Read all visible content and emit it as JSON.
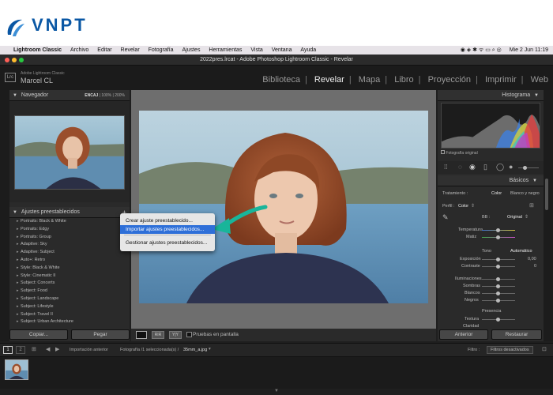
{
  "brand": {
    "name": "VNPT",
    "color": "#0a57a4"
  },
  "menubar": {
    "app": "Lightroom Classic",
    "items": [
      "Archivo",
      "Editar",
      "Revelar",
      "Fotografía",
      "Ajustes",
      "Herramientas",
      "Vista",
      "Ventana",
      "Ayuda"
    ],
    "datetime": "Mie 2 Jun 11:19"
  },
  "window": {
    "title": "2022pres.lrcat - Adobe Photoshop Lightroom Classic - Revelar"
  },
  "identity": {
    "logo": "Lrc",
    "product": "Adobe Lightroom Classic",
    "user": "Marcel CL"
  },
  "modules": {
    "items": [
      "Biblioteca",
      "Revelar",
      "Mapa",
      "Libro",
      "Proyección",
      "Imprimir",
      "Web"
    ],
    "active": "Revelar"
  },
  "navigator": {
    "title": "Navegador",
    "zoom_options": [
      "ENCAJ",
      "100%",
      "200%"
    ]
  },
  "presets": {
    "title": "Ajustes preestablecidos",
    "items": [
      "Portraits: Black & White",
      "Portraits: Edgy",
      "Portraits: Group",
      "Adaptive: Sky",
      "Adaptive: Subject",
      "Auto+: Retro",
      "Style: Black & White",
      "Style: Cinematic II",
      "Subject: Concerts",
      "Subject: Food",
      "Subject: Landscape",
      "Subject: Lifestyle",
      "Subject: Travel II",
      "Subject: Urban Architecture"
    ]
  },
  "left_buttons": {
    "copy": "Copiar...",
    "paste": "Pegar"
  },
  "context_menu": {
    "items": [
      "Crear ajuste preestablecido...",
      "Importar ajustes preestablecidos...",
      "Gestionar ajustes preestablecidos..."
    ],
    "highlighted": "Importar ajustes preestablecidos..."
  },
  "toolbar": {
    "proof": "Pruebas en pantalla"
  },
  "histogram": {
    "title": "Histograma",
    "label": "Fotografía original"
  },
  "basic": {
    "title": "Básicos",
    "treatment_label": "Tratamiento :",
    "treatment_options": [
      "Color",
      "Blanco y negro"
    ],
    "profile_label": "Perfil :",
    "profile_value": "Color",
    "wb_label": "BB :",
    "wb_value": "Original",
    "temp": "Temperatura",
    "tint": "Matiz",
    "tone": "Tono",
    "auto": "Automático",
    "exposure": "Exposición",
    "exposure_val": "0,00",
    "contrast": "Contraste",
    "contrast_val": "0",
    "highlights": "Iluminaciones",
    "shadows": "Sombras",
    "whites": "Blancos",
    "blacks": "Negros",
    "presence": "Presencia",
    "texture": "Textura",
    "clarity": "Claridad"
  },
  "right_buttons": {
    "previous": "Anterior",
    "reset": "Restaurar"
  },
  "filmbar": {
    "pages": [
      "1",
      "2"
    ],
    "prev_import": "Importación anterior",
    "path": "Fotografía /1 seleccionada(s) /",
    "filename": "35mm_a.jpg",
    "filter_label": "Filtro :",
    "filter_value": "Filtros desactivados"
  }
}
